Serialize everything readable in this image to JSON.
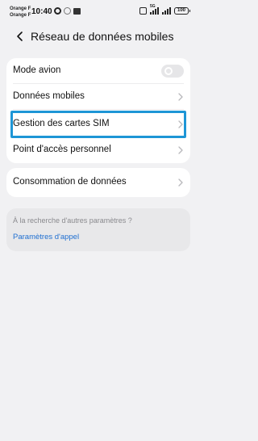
{
  "status_bar": {
    "carrier1": "Orange F",
    "carrier2": "Orange F",
    "time": "10:40",
    "network": "5G",
    "battery": "100"
  },
  "header": {
    "title": "Réseau de données mobiles",
    "back_icon": "chevron-left-icon"
  },
  "settings": {
    "mode_avion": {
      "label": "Mode avion",
      "toggle_on": false
    },
    "donnees_mobiles": {
      "label": "Données mobiles"
    },
    "gestion_sim": {
      "label": "Gestion des cartes SIM"
    },
    "point_acces": {
      "label": "Point d'accès personnel"
    },
    "consommation": {
      "label": "Consommation de données"
    }
  },
  "other": {
    "hint": "À la recherche d'autres paramètres ?",
    "link": "Paramètres d'appel"
  },
  "colors": {
    "highlight": "#1e96d6",
    "link": "#1f6fd1",
    "background": "#f1f1f3"
  }
}
